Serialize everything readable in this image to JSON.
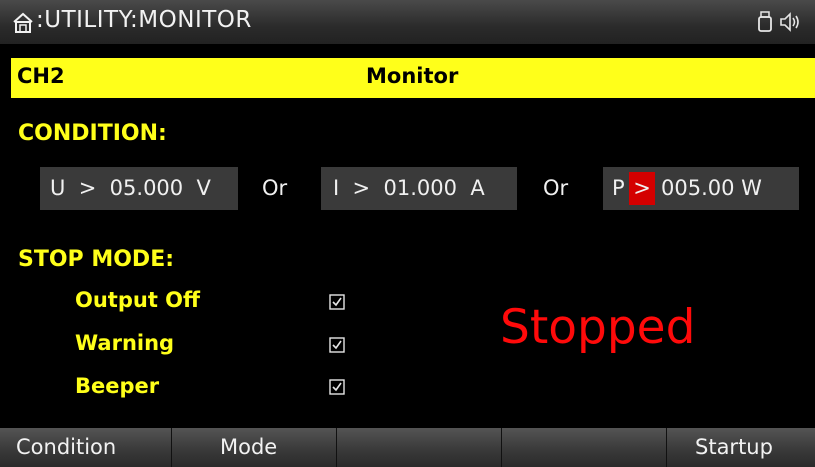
{
  "titlebar": {
    "title": ":UTILITY:MONITOR",
    "icons": [
      "home-icon",
      "usb-icon",
      "speaker-icon"
    ]
  },
  "channel_bar": {
    "channel": "CH2",
    "heading": "Monitor",
    "color": "#ffff1a"
  },
  "condition": {
    "label": "CONDITION:",
    "voltage": {
      "text": "U  >  05.000  V"
    },
    "or1": "Or",
    "current": {
      "text": "I  >  01.000  A"
    },
    "or2": "Or",
    "power": {
      "prefix": "P",
      "operator": ">",
      "value": "005.00 W",
      "operator_color": "#d40000"
    }
  },
  "stop_mode": {
    "label": "STOP MODE:",
    "items": [
      {
        "label": "Output Off",
        "checked": true
      },
      {
        "label": "Warning",
        "checked": true
      },
      {
        "label": "Beeper",
        "checked": true
      }
    ]
  },
  "status": {
    "text": "Stopped",
    "color": "#ff0a0a"
  },
  "softkeys": [
    "Condition",
    "Mode",
    "",
    "",
    "Startup"
  ]
}
